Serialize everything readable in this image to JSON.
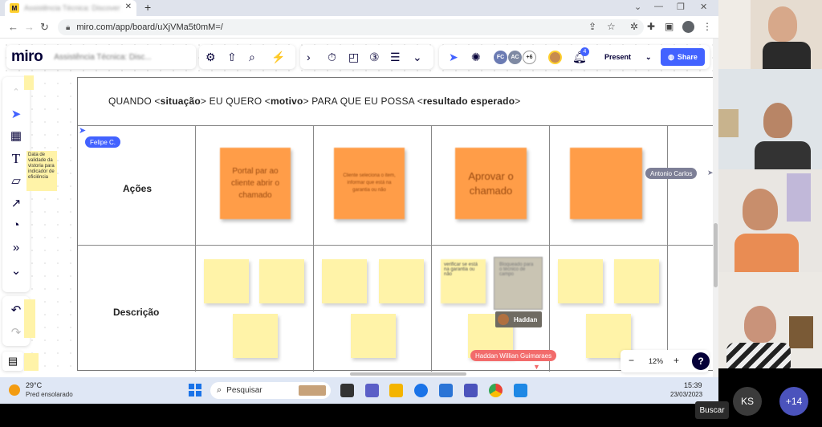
{
  "browser": {
    "tab_title": "Assistência Técnica: Discovery, O...",
    "tab_favicon": "M",
    "url": "miro.com/app/board/uXjVMa5t0mM=/"
  },
  "miro": {
    "logo": "miro",
    "board_name": "Assistência Técnica: Disc...",
    "avatars": [
      {
        "initials": "FC",
        "color": "#6b7bb3"
      },
      {
        "initials": "AC",
        "color": "#7f8aa3"
      }
    ],
    "avatar_more": "+6",
    "bell_badge": "4",
    "present_label": "Present",
    "share_label": "Share",
    "zoom_level": "12%",
    "help_label": "?"
  },
  "board": {
    "statement_parts": [
      "QUANDO <",
      "situação",
      ">  EU QUERO <",
      "motivo",
      ">  PARA QUE EU POSSA <",
      "resultado esperado",
      ">"
    ],
    "row_actions": "Ações",
    "row_description": "Descrição",
    "orange_notes": [
      "Portal par ao cliente abrir o chamado",
      "Cliente seleciona o item, informar que está na garantia ou não",
      "Aprovar o chamado",
      ""
    ],
    "yellow_text_note": "verificar se está na garantia ou não",
    "grey_note": "Bloqueado para o técnico de campo",
    "side_note": "Data de validade da vistoria para indicador de eficiência"
  },
  "cursors": {
    "felipe": "Felipe C.",
    "antonio": "Antonio Carlos",
    "haddan_full": "Haddan Willian Guimaraes",
    "haddan_short": "Haddan"
  },
  "taskbar": {
    "temperature": "29°C",
    "weather": "Pred ensolarado",
    "search_placeholder": "Pesquisar",
    "time": "15:39",
    "date": "23/03/2023"
  },
  "meeting": {
    "self_initials": "KS",
    "more_participants": "+14",
    "tooltip": "Buscar"
  }
}
